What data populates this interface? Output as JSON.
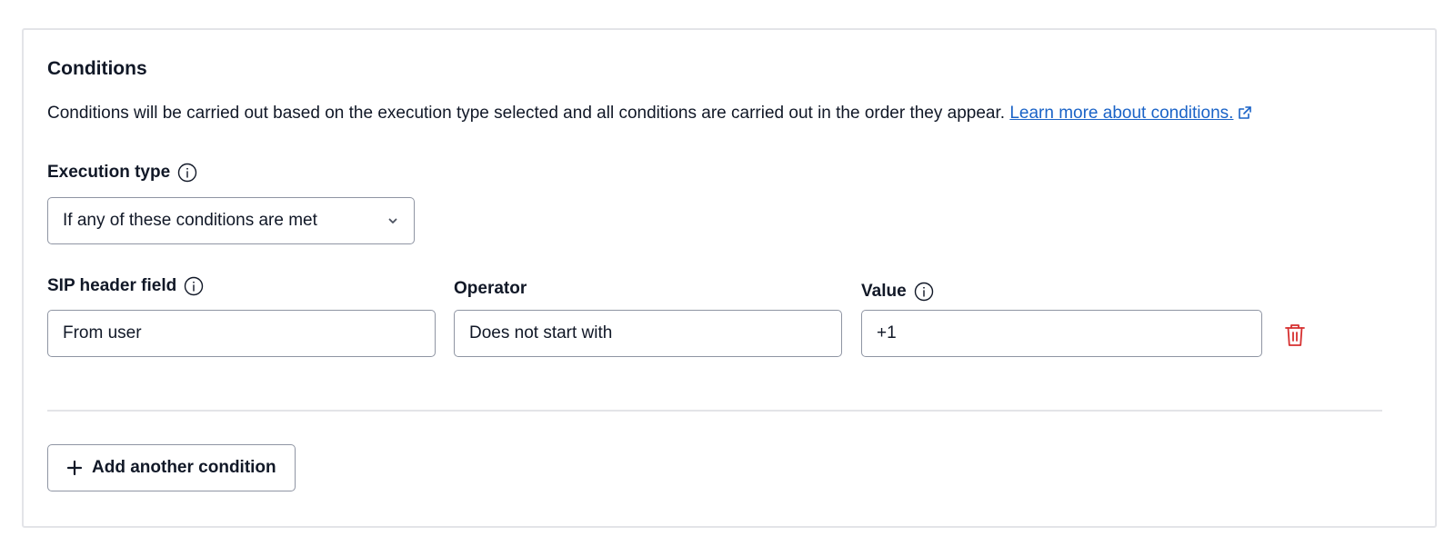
{
  "conditions": {
    "title": "Conditions",
    "description": "Conditions will be carried out based on the execution type selected and all conditions are carried out in the order they appear.",
    "learn_more_link": "Learn more about conditions.",
    "execution_type": {
      "label": "Execution type",
      "value": "If any of these conditions are met"
    },
    "row": {
      "sip_header_label": "SIP header field",
      "sip_header_value": "From user",
      "operator_label": "Operator",
      "operator_value": "Does not start with",
      "value_label": "Value",
      "value_value": "+1"
    },
    "add_button_label": "Add another condition"
  },
  "icons": {
    "info": "info-circle-icon",
    "external": "external-link-icon",
    "chevron": "chevron-down-icon",
    "delete": "trash-icon",
    "add": "plus-icon"
  },
  "colors": {
    "link": "#1a63c7",
    "delete": "#d62f2f",
    "border": "#8f95a3",
    "text": "#111827"
  }
}
